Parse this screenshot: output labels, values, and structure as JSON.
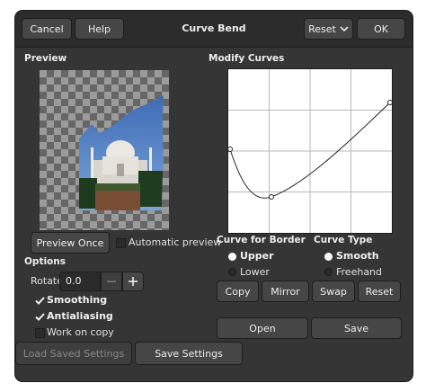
{
  "header": {
    "cancel_label": "Cancel",
    "help_label": "Help",
    "title": "Curve Bend",
    "reset_label": "Reset",
    "ok_label": "OK"
  },
  "preview": {
    "section_label": "Preview",
    "preview_once_label": "Preview Once",
    "automatic_preview_label": "Automatic preview",
    "automatic_preview_checked": false
  },
  "curves": {
    "section_label": "Modify Curves",
    "curve_for_border_label": "Curve for Border",
    "border_options": [
      {
        "label": "Upper",
        "selected": true
      },
      {
        "label": "Lower",
        "selected": false
      }
    ],
    "curve_type_label": "Curve Type",
    "type_options": [
      {
        "label": "Smooth",
        "selected": true
      },
      {
        "label": "Freehand",
        "selected": false
      }
    ],
    "buttons": {
      "copy": "Copy",
      "mirror": "Mirror",
      "swap": "Swap",
      "reset": "Reset"
    },
    "open_label": "Open",
    "save_label": "Save"
  },
  "options": {
    "section_label": "Options",
    "rotate_label": "Rotate",
    "rotate_value": "0.0",
    "smoothing_label": "Smoothing",
    "smoothing_checked": true,
    "antialiasing_label": "Antialiasing",
    "antialiasing_checked": true,
    "work_on_copy_label": "Work on copy",
    "work_on_copy_checked": false
  },
  "footer": {
    "load_saved_settings_label": "Load Saved Settings",
    "save_settings_label": "Save Settings"
  },
  "colors": {
    "window_bg": "#353535",
    "button_bg": "#464646",
    "accent_selected": "#ffffff"
  }
}
